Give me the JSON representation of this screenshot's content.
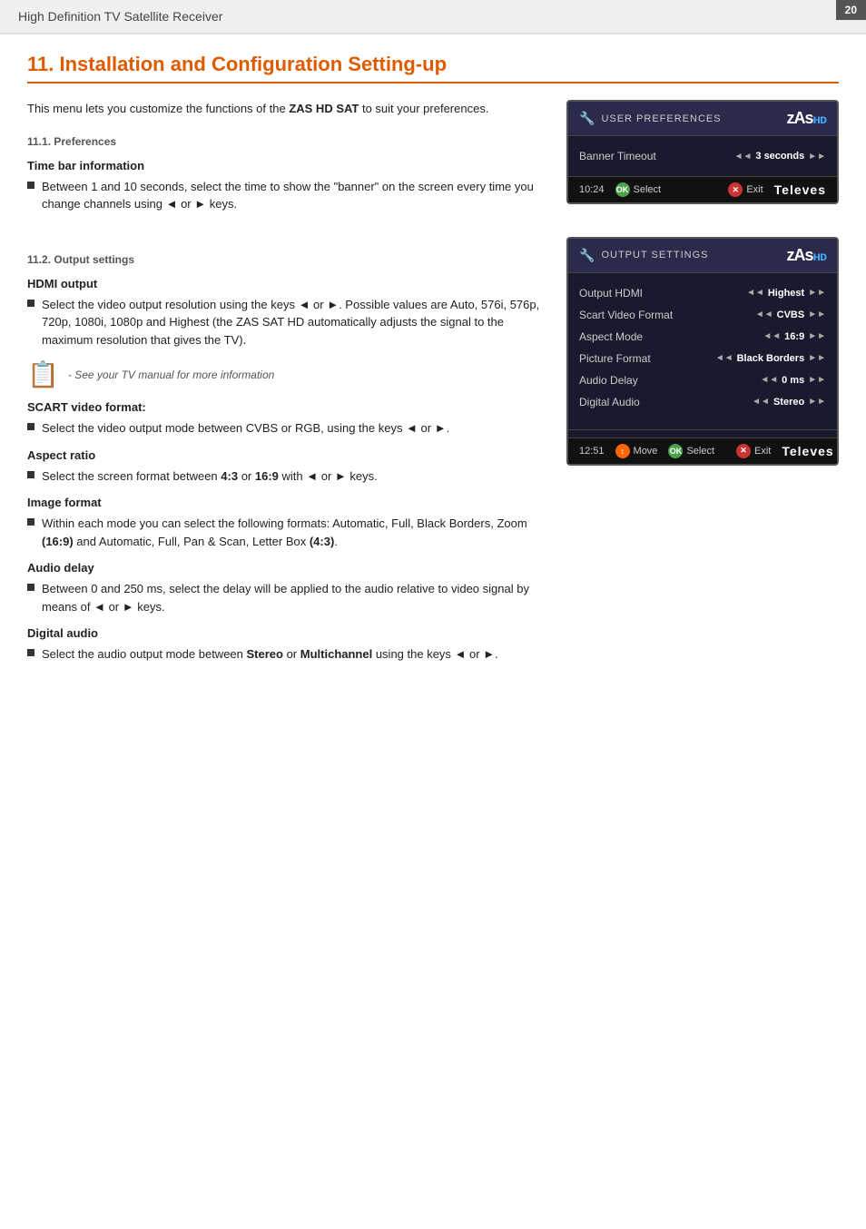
{
  "page": {
    "number": "20",
    "header": "High Definition TV Satellite Receiver"
  },
  "chapter": {
    "number": "11",
    "title": "Installation and Configuration Setting-up",
    "intro": "This menu lets you customize the functions of the ZAS HD SAT to suit your preferences."
  },
  "section11_1": {
    "heading": "11.1. Preferences",
    "subsection_time_bar": {
      "label": "Time bar information",
      "bullet": "Between 1 and 10 seconds, select the time to show the \"banner\" on the screen every time you change channels using ◄ or ► keys."
    }
  },
  "screen_user_prefs": {
    "menu_icon": "🔧",
    "menu_title": "USER PREFERENCES",
    "brand": "zAs",
    "brand_hd": "HD",
    "rows": [
      {
        "label": "Banner Timeout",
        "value": "3 seconds"
      }
    ],
    "footer": {
      "time": "10:24",
      "btn_select_label": "Select",
      "btn_exit_label": "Exit",
      "brand": "Televes"
    }
  },
  "section11_2": {
    "heading": "11.2. Output settings",
    "subsection_hdmi": {
      "label": "HDMI output",
      "bullet": "Select the video output resolution using the keys ◄ or ►. Possible values are Auto, 576i, 576p, 720p, 1080i, 1080p and Highest (the ZAS SAT HD automatically adjusts the signal to the maximum resolution that gives the TV)."
    },
    "note_text": "- See your TV manual for more information",
    "subsection_scart": {
      "label": "SCART video format:",
      "bullet": "Select the video output mode between CVBS or RGB, using the keys ◄ or ►."
    },
    "subsection_aspect": {
      "label": "Aspect ratio",
      "bullet": "Select the screen format between 4:3 or 16:9 with ◄ or ► keys."
    },
    "subsection_image": {
      "label": "Image format",
      "bullet": "Within each mode you can select the following formats: Automatic, Full, Black Borders, Zoom (16:9) and Automatic, Full, Pan & Scan, Letter Box (4:3)."
    },
    "subsection_audio_delay": {
      "label": "Audio delay",
      "bullet": "Between 0 and 250 ms, select the delay will be applied to the audio relative to video signal by means of ◄ or ► keys."
    },
    "subsection_digital_audio": {
      "label": "Digital audio",
      "bullet": "Select the audio output mode between Stereo or Multichannel using the keys ◄ or ►."
    }
  },
  "screen_output_settings": {
    "menu_icon": "🔧",
    "menu_title": "OUTPUT SETTINGS",
    "brand": "zAs",
    "brand_hd": "HD",
    "rows": [
      {
        "label": "Output HDMI",
        "value": "Highest"
      },
      {
        "label": "Scart Video Format",
        "value": "CVBS"
      },
      {
        "label": "Aspect Mode",
        "value": "16:9"
      },
      {
        "label": "Picture Format",
        "value": "Black Borders"
      },
      {
        "label": "Audio Delay",
        "value": "0 ms"
      },
      {
        "label": "Digital Audio",
        "value": "Stereo"
      }
    ],
    "footer": {
      "time": "12:51",
      "btn_move_label": "Move",
      "btn_select_label": "Select",
      "btn_exit_label": "Exit",
      "brand": "Televes"
    }
  }
}
